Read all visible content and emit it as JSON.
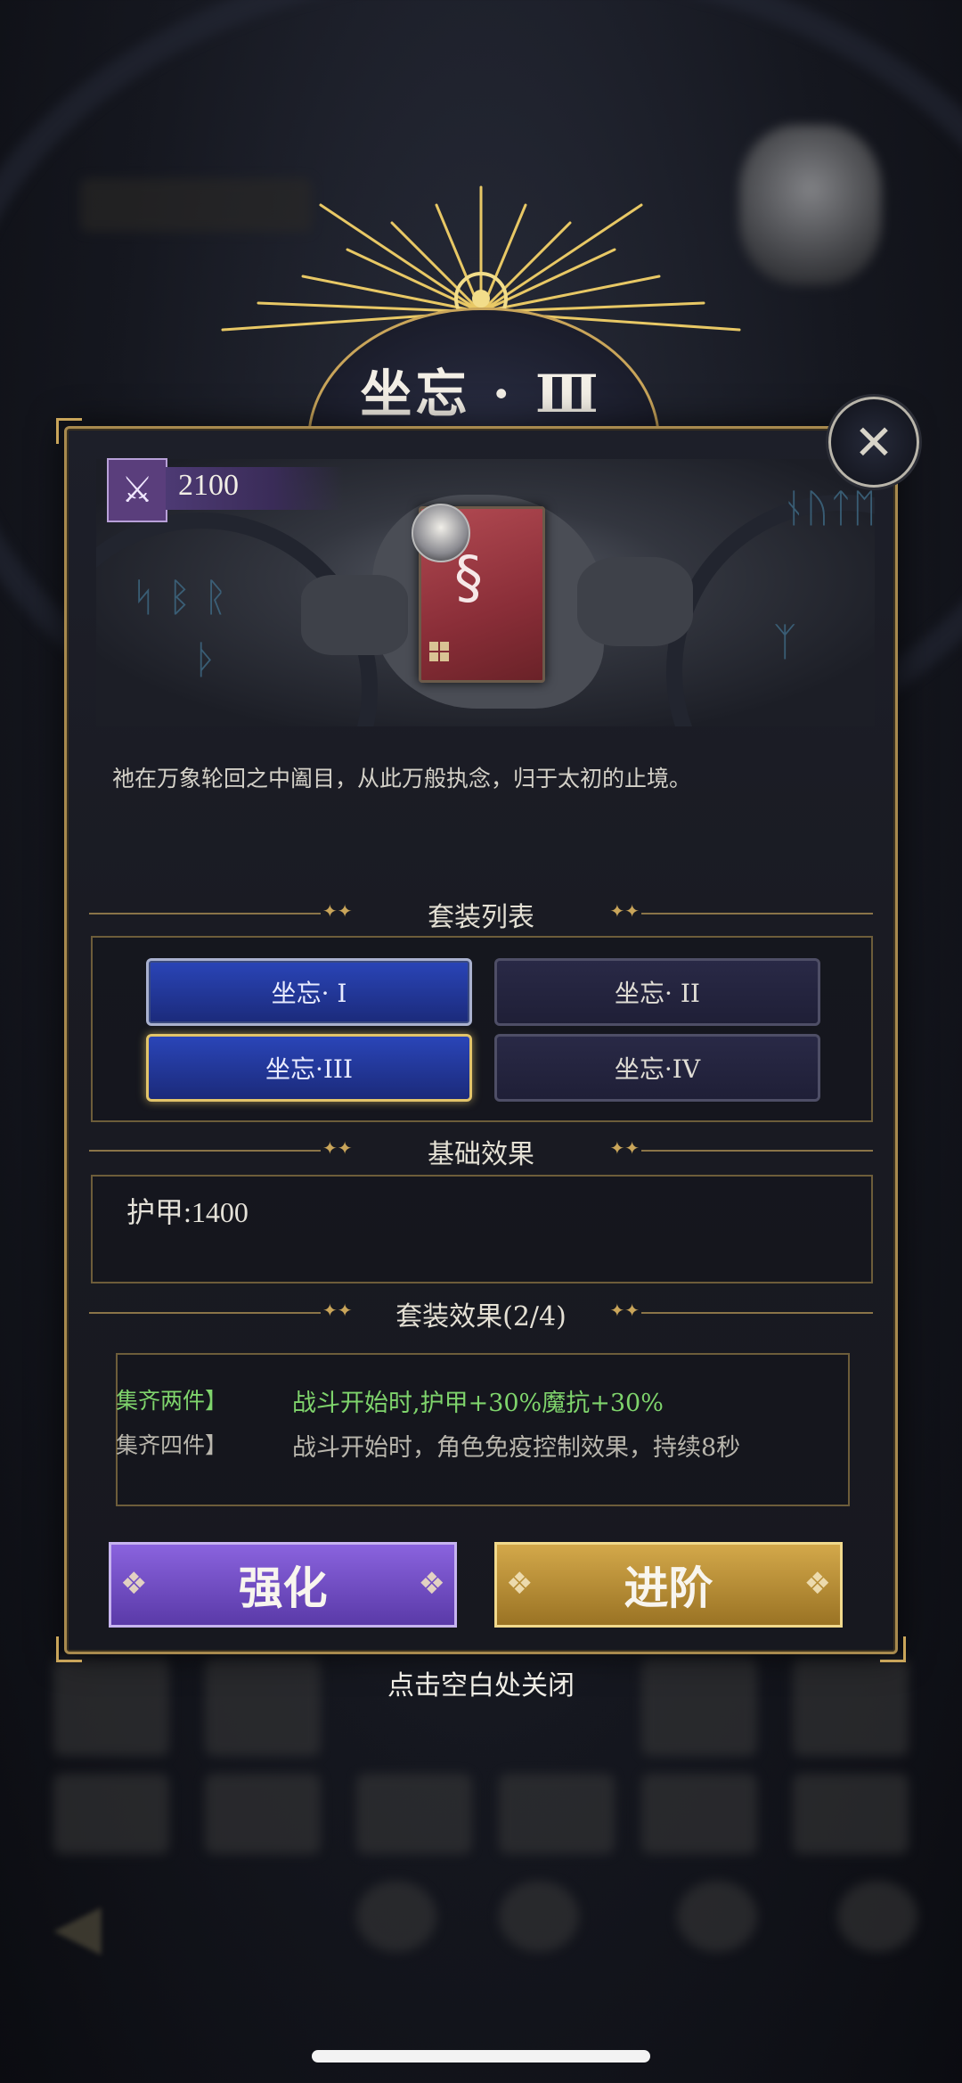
{
  "equipment": {
    "title": "坐忘 · Ⅲ",
    "power": "2100",
    "description": "祂在万象轮回之中阖目，从此万般执念，归于太初的止境。"
  },
  "sections": {
    "set_list_title": "套装列表",
    "base_effect_title": "基础效果",
    "set_effect_title": "套装效果(2/4)"
  },
  "set_list": [
    {
      "label": "坐忘· I",
      "state": "active"
    },
    {
      "label": "坐忘· II",
      "state": "inactive"
    },
    {
      "label": "坐忘·III",
      "state": "selected"
    },
    {
      "label": "坐忘·IV",
      "state": "inactive"
    }
  ],
  "base_effect": "护甲:1400",
  "set_effects": [
    {
      "requirement": "集齐两件】",
      "effect": "战斗开始时,护甲+30%魔抗+30%",
      "active": true
    },
    {
      "requirement": "集齐四件】",
      "effect": "战斗开始时，角色免疫控制效果，持续8秒",
      "active": false
    }
  ],
  "buttons": {
    "enhance": "强化",
    "advance": "进阶"
  },
  "close_hint": "点击空白处关闭",
  "colors": {
    "gold_border": "#c9a55a",
    "enhance_purple": "#6b48c0",
    "advance_gold": "#c09538",
    "active_effect_green": "#7fd46c",
    "set_button_blue": "#2a45b8"
  },
  "icons": {
    "close": "crossed-arrows-close-icon",
    "power": "crossed-swords-icon",
    "card": "serpent-emblem-icon"
  }
}
